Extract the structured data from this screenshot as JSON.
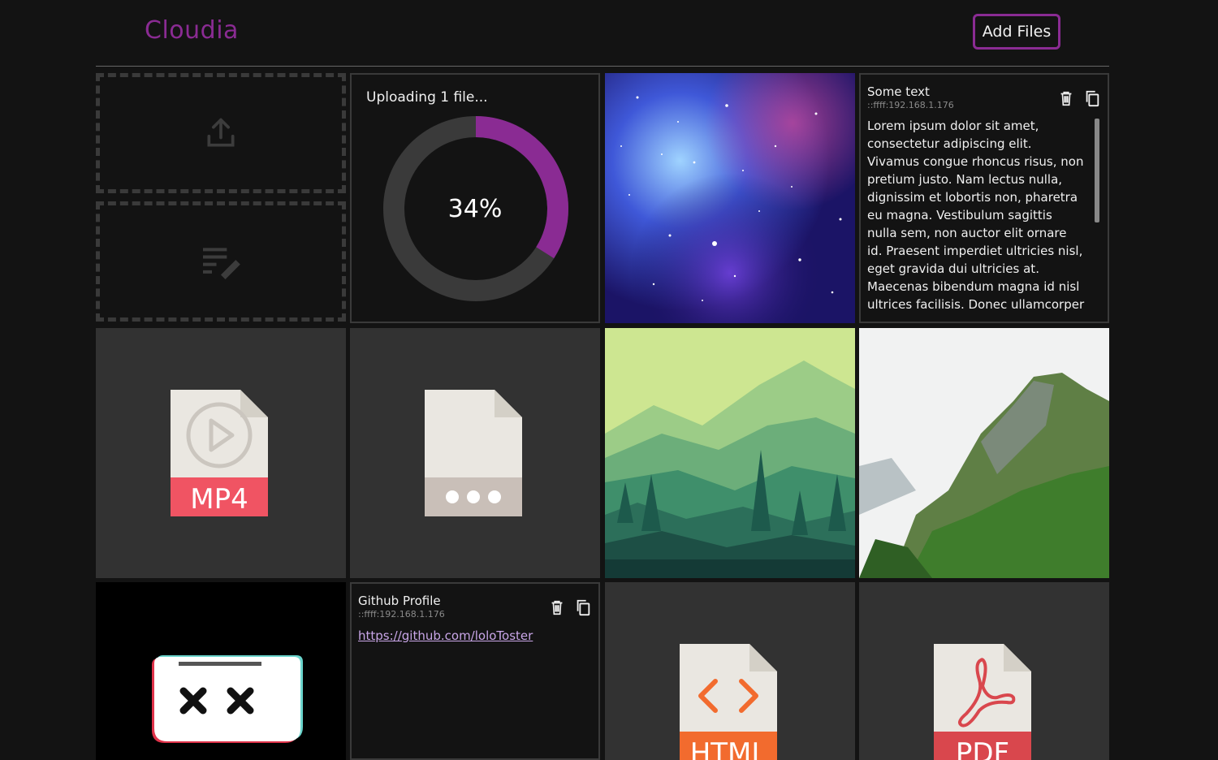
{
  "header": {
    "brand": "Cloudia",
    "add_files_label": "Add Files"
  },
  "upload": {
    "label": "Uploading 1 file...",
    "progress_percent": 34,
    "progress_text": "34%"
  },
  "notes": [
    {
      "title": "Some text",
      "ip": "::ffff:192.168.1.176",
      "body": "Lorem ipsum dolor sit amet, consectetur adipiscing elit. Vivamus congue rhoncus risus, non pretium justo. Nam lectus nulla, dignissim et lobortis non, pharetra eu magna. Vestibulum sagittis nulla sem, non auctor elit ornare id. Praesent imperdiet ultricies nisl, eget gravida dui ultricies at. Maecenas bibendum magna id nisl ultrices facilisis. Donec ullamcorper nibh quis metus congue"
    },
    {
      "title": "Github Profile",
      "ip": "::ffff:192.168.1.176",
      "link": "https://github.com/loloToster"
    }
  ],
  "file_icons": {
    "mp4": "MP4",
    "html": "HTML",
    "pdf": "PDF"
  },
  "colors": {
    "accent": "#8a2b93",
    "background": "#131313",
    "tile_gray": "#323232",
    "mp4_red": "#f05463",
    "html_orange": "#f26b2e",
    "pdf_red": "#d9474d"
  },
  "icons": {
    "upload": "upload-icon",
    "note": "edit-note-icon",
    "delete": "trash-icon",
    "copy": "copy-icon"
  }
}
